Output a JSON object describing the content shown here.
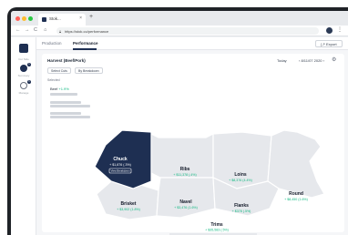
{
  "browser": {
    "tab_title": "Stok...",
    "tab_close": "×",
    "new_tab": "+",
    "url": "https://stok.co/performance",
    "nav_back": "←",
    "nav_forward": "→",
    "nav_reload": "C",
    "nav_home": "⌂",
    "menu": "⋮"
  },
  "sidebar": {
    "section_label": "Cut Side",
    "items": [
      {
        "label": "Summary",
        "badge": "1"
      },
      {
        "label": "Manage",
        "badge": "1"
      }
    ]
  },
  "topnav": {
    "tabs": [
      "Production",
      "Performance"
    ],
    "active_tab": "Performance",
    "export_label": "Export"
  },
  "header": {
    "title": "Harvest (Beef/Pork)",
    "period": "Today",
    "date": "8/11/07 2020",
    "prev": "‹",
    "next": "›",
    "settings": "⚙"
  },
  "filters": {
    "btn1": "Select Cuts",
    "btn2": "By Breakdown"
  },
  "panel": {
    "heading": "Selected",
    "category": "Beef",
    "category_change": "+1.9%"
  },
  "cuts": [
    {
      "name": "Chuck",
      "value": "+ $1,876 (.3%)",
      "button": "View Breakdown",
      "highlight": true
    },
    {
      "name": "Ribs",
      "value": "+ $11,378 (.4%)"
    },
    {
      "name": "Loins",
      "value": "+ $8,376 (4.4%)"
    },
    {
      "name": "Round",
      "value": "+ $8,450 (1.6%)"
    },
    {
      "name": "Brisket",
      "value": "+ $3,902 (1.8%)"
    },
    {
      "name": "Navel",
      "value": "+ $3,476 (1.6%)"
    },
    {
      "name": "Flanks",
      "value": "+ $378 (.5%)"
    }
  ],
  "trims": {
    "name": "Trims",
    "value": "+ $35,583 (.5%)",
    "left_value": "-5%",
    "right_value": "+ $4M"
  },
  "colors": {
    "brand": "#1e2f52",
    "positive": "#10b981",
    "cut_fill": "#e6e8ec"
  }
}
